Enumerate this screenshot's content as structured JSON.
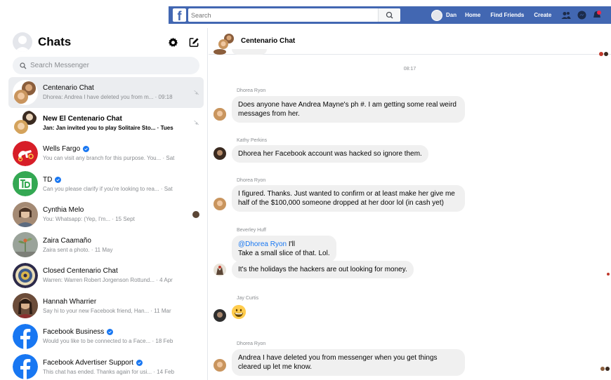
{
  "topbar": {
    "logo": "f",
    "search_placeholder": "Search",
    "user_name": "Dan",
    "links": [
      "Home",
      "Find Friends",
      "Create"
    ],
    "accent": "#4267b2"
  },
  "sidebar": {
    "title": "Chats",
    "search_placeholder": "Search Messenger",
    "chats": [
      {
        "name": "Centenario Chat",
        "preview": "Dhorea: Andrea I have deleted you from m... · 09:18",
        "unread": false,
        "active": true,
        "verified": false,
        "avatar": "group-photo",
        "aux": "muted-icon"
      },
      {
        "name": "New El Centenario Chat",
        "preview": "Jan: Jan invited you to play Solitaire Sto... · Tues",
        "unread": true,
        "active": false,
        "verified": false,
        "avatar": "group-photo",
        "aux": "muted-icon"
      },
      {
        "name": "Wells Fargo",
        "preview": "You can visit any branch for this purpose. You... · Sat",
        "unread": false,
        "active": false,
        "verified": true,
        "avatar": "wells-fargo-logo",
        "aux": ""
      },
      {
        "name": "TD",
        "preview": "Can you please clarify if you're looking to rea... · Sat",
        "unread": false,
        "active": false,
        "verified": true,
        "avatar": "td-logo",
        "aux": ""
      },
      {
        "name": "Cynthia Melo",
        "preview": "You: Whatsapp:                    (Yep, I'm... · 15 Sept",
        "unread": false,
        "active": false,
        "verified": false,
        "avatar": "person-photo",
        "aux": "seen-avatar"
      },
      {
        "name": "Zaira Caamaño",
        "preview": "Zaira sent a photo. · 11 May",
        "unread": false,
        "active": false,
        "verified": false,
        "avatar": "plant-photo",
        "aux": ""
      },
      {
        "name": "Closed Centenario Chat",
        "preview": "Warren: Warren Robert Jorgenson Rottund... · 4 Apr",
        "unread": false,
        "active": false,
        "verified": false,
        "avatar": "seal-photo",
        "aux": ""
      },
      {
        "name": "Hannah Wharrier",
        "preview": "Say hi to your new Facebook friend, Han... · 11 Mar",
        "unread": false,
        "active": false,
        "verified": false,
        "avatar": "person-photo",
        "aux": ""
      },
      {
        "name": "Facebook Business",
        "preview": "Would you like to be connected to a Face... · 18 Feb",
        "unread": false,
        "active": false,
        "verified": true,
        "avatar": "facebook-logo",
        "aux": ""
      },
      {
        "name": "Facebook Advertiser Support",
        "preview": "This chat has ended. Thanks again for usi... · 14 Feb",
        "unread": false,
        "active": false,
        "verified": true,
        "avatar": "facebook-logo",
        "aux": ""
      }
    ]
  },
  "conversation": {
    "title": "Centenario Chat",
    "timestamp": "08:17",
    "messages": [
      {
        "sender": "Dhorea Ryon",
        "text": "Does anyone have Andrea Mayne's ph #. I am getting some real weird messages from her."
      },
      {
        "sender": "Kathy Perkins",
        "text": "Dhorea her Facebook account was hacked so ignore them."
      },
      {
        "sender": "Dhorea Ryon",
        "text": "I figured. Thanks. Just wanted to confirm or at least make her give me half of the $100,000 someone dropped at her door lol (in cash yet)"
      },
      {
        "sender": "Beverley Huff",
        "mention": "@Dhorea Ryon",
        "text_after_mention": " I'll",
        "text_line2": "Take a small slice of that. Lol."
      },
      {
        "text": "It's the holidays the hackers are out looking for money."
      },
      {
        "sender": "Jay Curtis",
        "emoji": "grinning-face"
      },
      {
        "sender": "Dhorea Ryon",
        "text": "Andrea I have deleted you from messenger when you get things cleared up let me know."
      }
    ]
  }
}
